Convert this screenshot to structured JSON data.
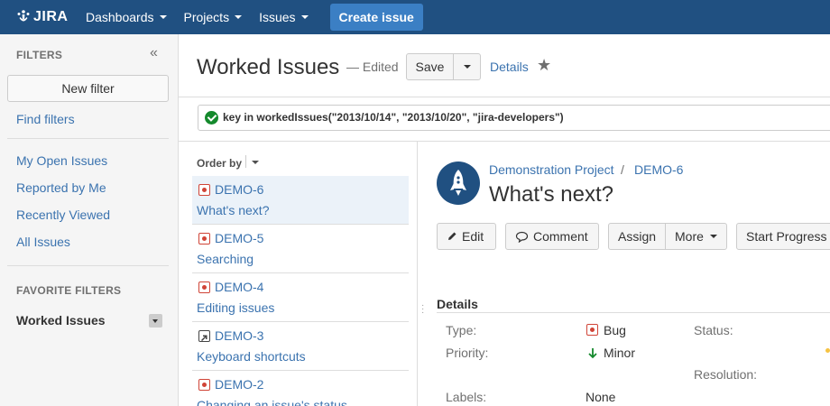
{
  "nav": {
    "logo_text": "JIRA",
    "items": [
      {
        "label": "Dashboards"
      },
      {
        "label": "Projects"
      },
      {
        "label": "Issues"
      }
    ],
    "create_label": "Create issue"
  },
  "sidebar": {
    "header": "FILTERS",
    "new_filter": "New filter",
    "find_filters": "Find filters",
    "links": [
      "My Open Issues",
      "Reported by Me",
      "Recently Viewed",
      "All Issues"
    ],
    "favorites_header": "FAVORITE FILTERS",
    "favorite": "Worked Issues"
  },
  "header": {
    "title": "Worked Issues",
    "edited": "— Edited",
    "save": "Save",
    "details": "Details"
  },
  "jql": "key in workedIssues(\"2013/10/14\", \"2013/10/20\", \"jira-developers\")",
  "list": {
    "order_by": "Order by",
    "issues": [
      {
        "key": "DEMO-6",
        "summary": "What's next?",
        "type": "bug"
      },
      {
        "key": "DEMO-5",
        "summary": "Searching",
        "type": "bug"
      },
      {
        "key": "DEMO-4",
        "summary": "Editing issues",
        "type": "bug"
      },
      {
        "key": "DEMO-3",
        "summary": "Keyboard shortcuts",
        "type": "improvement"
      },
      {
        "key": "DEMO-2",
        "summary": "Changing an issue's status",
        "type": "bug"
      }
    ]
  },
  "issue": {
    "project": "Demonstration Project",
    "separator": "/",
    "key": "DEMO-6",
    "title": "What's next?",
    "buttons": {
      "edit": "Edit",
      "comment": "Comment",
      "assign": "Assign",
      "more": "More",
      "start_progress": "Start Progress"
    },
    "details_header": "Details",
    "fields": {
      "type_label": "Type:",
      "type_value": "Bug",
      "priority_label": "Priority:",
      "priority_value": "Minor",
      "labels_label": "Labels:",
      "labels_value": "None",
      "status_label": "Status:",
      "resolution_label": "Resolution:"
    }
  },
  "colors": {
    "nav_bg": "#205081",
    "link": "#3b73af",
    "bug": "#d04437",
    "ok": "#14892c",
    "selected_row": "#ebf2f9"
  }
}
